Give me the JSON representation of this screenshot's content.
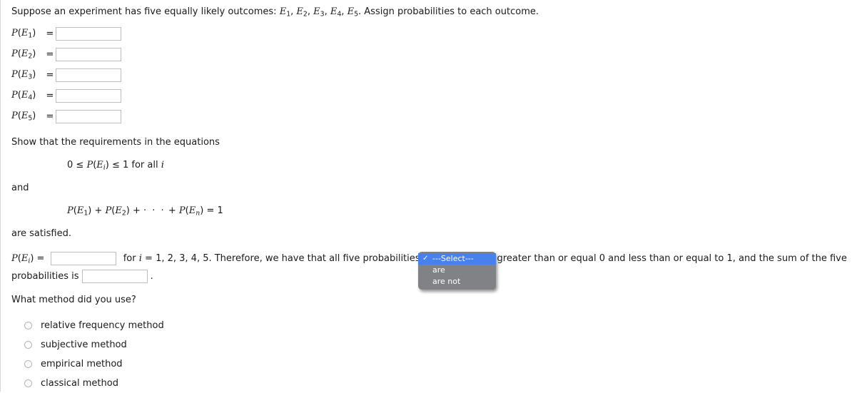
{
  "problem": {
    "intro_prefix": "Suppose an experiment has five equally likely outcomes: ",
    "intro_outcomes": "E1, E2, E3, E4, E5",
    "intro_suffix": ". Assign probabilities to each outcome."
  },
  "probability_inputs": [
    {
      "label_base": "P(E",
      "label_sub": "1",
      "label_close": ")",
      "equals": "=",
      "value": "",
      "placeholder": ""
    },
    {
      "label_base": "P(E",
      "label_sub": "2",
      "label_close": ")",
      "equals": "=",
      "value": "",
      "placeholder": ""
    },
    {
      "label_base": "P(E",
      "label_sub": "3",
      "label_close": ")",
      "equals": "=",
      "value": "",
      "placeholder": ""
    },
    {
      "label_base": "P(E",
      "label_sub": "4",
      "label_close": ")",
      "equals": "=",
      "value": "",
      "placeholder": ""
    },
    {
      "label_base": "P(E",
      "label_sub": "5",
      "label_close": ")",
      "equals": "=",
      "value": "",
      "placeholder": ""
    }
  ],
  "statements": {
    "show_requirements": "Show that the requirements in the equations",
    "equation_1": "0 ≤ P(Ei) ≤ 1 for all i",
    "and": "and",
    "equation_2": "P(E1) + P(E2) + · · · + P(En) = 1",
    "are_satisfied": "are satisfied."
  },
  "conclusion": {
    "pei_label": "P(Ei) =",
    "pei_value": "",
    "mid_text": "for i = 1, 2, 3, 4, 5. Therefore, we have that all five probabilities",
    "after_select_text": "greater than or equal 0 and less than or equal to 1, and the sum of the five",
    "sum_prefix": "probabilities is",
    "sum_value": "",
    "period": "."
  },
  "select_popup": {
    "name": "are-are-not-select",
    "open": true,
    "selected_index": 0,
    "check_glyph": "✓",
    "highlight_color": "#4880ee",
    "background_color": "#808285",
    "options": [
      {
        "label": "---Select---",
        "checked": true
      },
      {
        "label": "are",
        "checked": false
      },
      {
        "label": "are not",
        "checked": false
      }
    ]
  },
  "method_question": {
    "title": "What method did you use?",
    "options": [
      {
        "label": "relative frequency method",
        "selected": false
      },
      {
        "label": "subjective method",
        "selected": false
      },
      {
        "label": "empirical method",
        "selected": false
      },
      {
        "label": "classical method",
        "selected": false
      }
    ]
  }
}
